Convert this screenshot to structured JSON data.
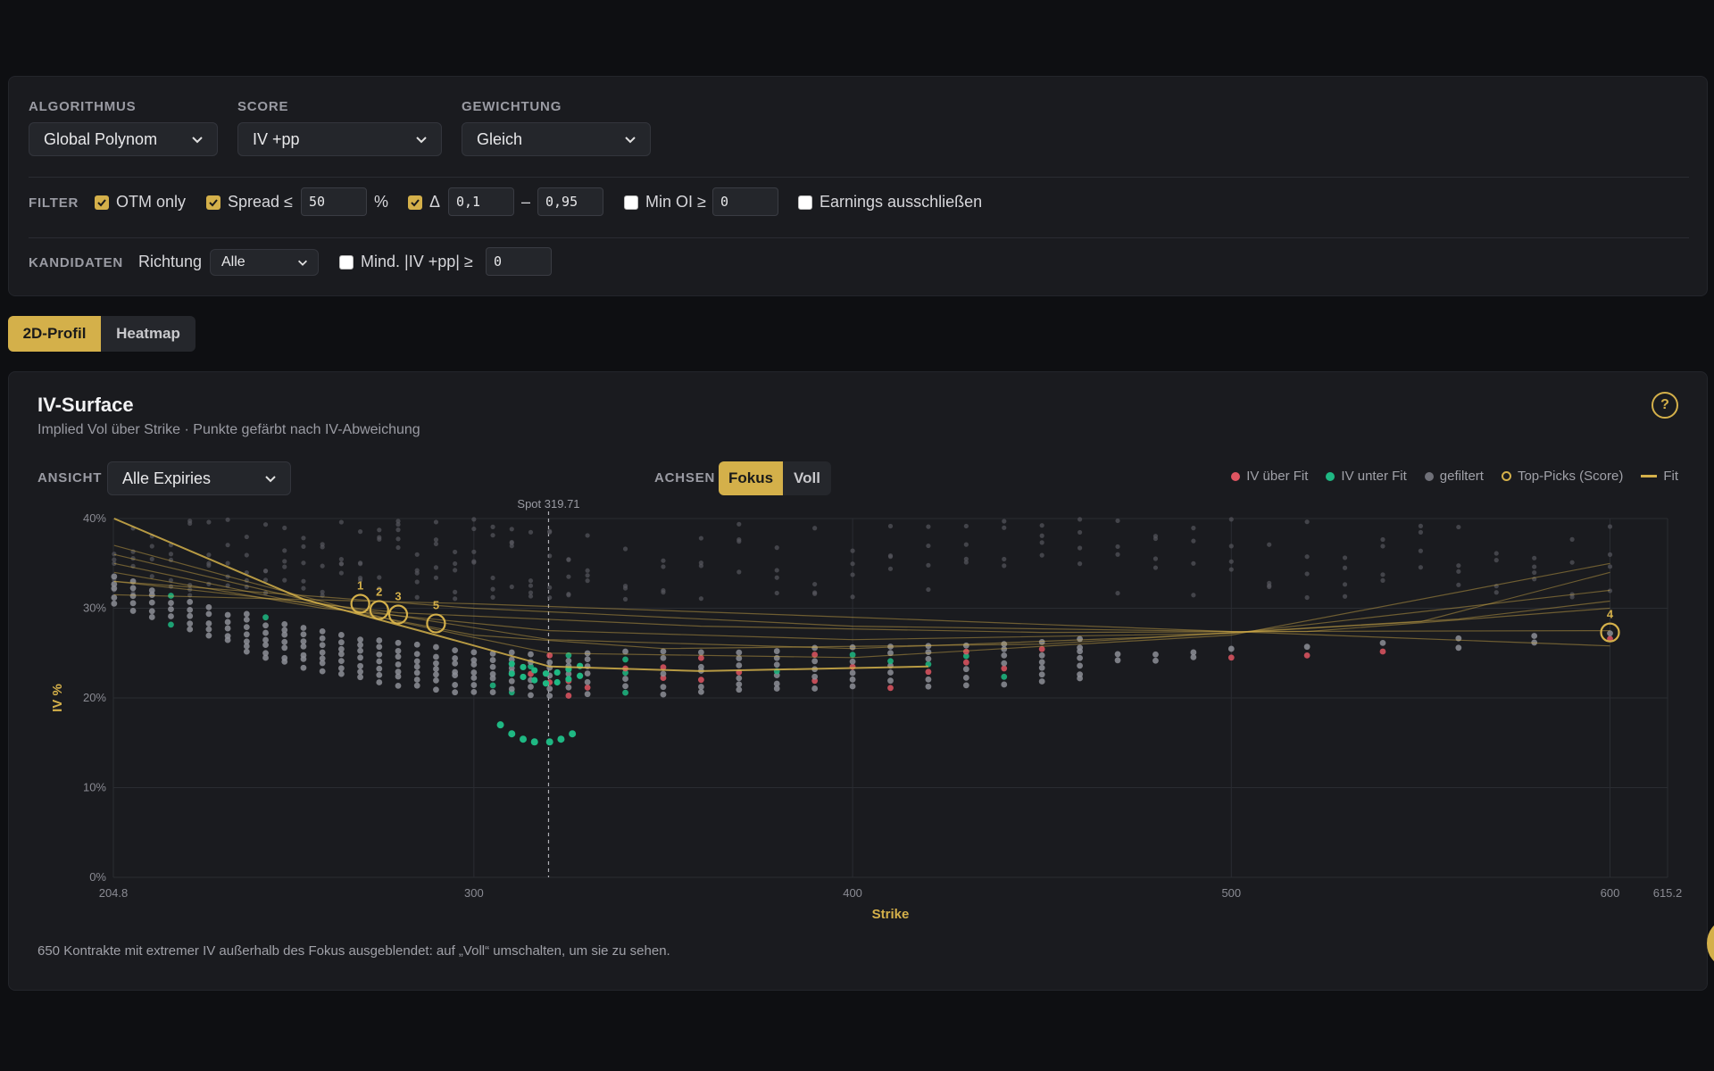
{
  "controls": {
    "algorithm": {
      "label": "ALGORITHMUS",
      "value": "Global Polynom"
    },
    "score": {
      "label": "SCORE",
      "value": "IV +pp"
    },
    "weighting": {
      "label": "GEWICHTUNG",
      "value": "Gleich"
    },
    "filter": {
      "label": "FILTER",
      "otm_label": "OTM only",
      "spread_label": "Spread ≤",
      "spread_value": "50",
      "spread_unit": "%",
      "delta_label": "Δ",
      "delta_min": "0,1",
      "delta_sep": "–",
      "delta_max": "0,95",
      "min_oi_label": "Min OI ≥",
      "min_oi_value": "0",
      "earnings_label": "Earnings ausschließen"
    },
    "candidates": {
      "label": "KANDIDATEN",
      "direction_label": "Richtung",
      "direction_value": "Alle",
      "min_iv_label": "Mind. |IV +pp| ≥",
      "min_iv_value": "0"
    }
  },
  "view_tabs": [
    "2D-Profil",
    "Heatmap"
  ],
  "panel": {
    "title": "IV-Surface",
    "subtitle": "Implied Vol über Strike · Punkte gefärbt nach IV-Abweichung",
    "help": "?",
    "view_label": "ANSICHT",
    "view_value": "Alle Expiries",
    "axes_label": "ACHSEN",
    "axes_options": [
      "Fokus",
      "Voll"
    ],
    "legend": [
      "IV über Fit",
      "IV unter Fit",
      "gefiltert",
      "Top-Picks (Score)",
      "Fit"
    ],
    "note": "650 Kontrakte mit extremer IV außerhalb des Fokus ausgeblendet: auf „Voll“ umschalten, um sie zu sehen."
  },
  "colors": {
    "accent": "#d4b04a",
    "above": "#e05561",
    "below": "#1fb883",
    "filtered": "#6f7078"
  },
  "chart_data": {
    "type": "scatter",
    "xlabel": "Strike",
    "ylabel": "IV %",
    "xlim": [
      204.8,
      615.2
    ],
    "ylim": [
      0,
      40
    ],
    "x_ticks": [
      "204.8",
      "300",
      "400",
      "500",
      "600",
      "615.2"
    ],
    "y_ticks": [
      "0%",
      "10%",
      "20%",
      "30%",
      "40%"
    ],
    "spot": {
      "label": "Spot 319.71",
      "value": 319.71
    },
    "grid": true,
    "top_picks": [
      {
        "rank": "1",
        "strike": 270,
        "iv": 30.5
      },
      {
        "rank": "2",
        "strike": 275,
        "iv": 29.8
      },
      {
        "rank": "3",
        "strike": 280,
        "iv": 29.3
      },
      {
        "rank": "5",
        "strike": 290,
        "iv": 28.3
      },
      {
        "rank": "4",
        "strike": 600,
        "iv": 27.3
      }
    ],
    "below_fit_smile": [
      {
        "strike": 307,
        "iv": 17.0
      },
      {
        "strike": 310,
        "iv": 16.0
      },
      {
        "strike": 313,
        "iv": 15.4
      },
      {
        "strike": 316,
        "iv": 15.1
      },
      {
        "strike": 320,
        "iv": 15.1
      },
      {
        "strike": 323,
        "iv": 15.4
      },
      {
        "strike": 326,
        "iv": 16.0
      }
    ],
    "fit_curves": [
      {
        "points": [
          [
            205,
            40
          ],
          [
            230,
            35.5
          ],
          [
            255,
            31
          ],
          [
            290,
            27
          ],
          [
            320,
            23.5
          ],
          [
            360,
            23
          ],
          [
            420,
            23.5
          ]
        ]
      },
      {
        "points": [
          [
            205,
            37
          ],
          [
            240,
            33
          ],
          [
            280,
            28.5
          ],
          [
            320,
            25
          ],
          [
            400,
            24.5
          ],
          [
            500,
            27
          ],
          [
            600,
            35
          ]
        ]
      },
      {
        "points": [
          [
            205,
            35
          ],
          [
            250,
            31
          ],
          [
            300,
            27
          ],
          [
            350,
            25.5
          ],
          [
            450,
            26
          ],
          [
            550,
            28.5
          ],
          [
            600,
            34
          ]
        ]
      },
      {
        "points": [
          [
            205,
            34
          ],
          [
            260,
            30
          ],
          [
            320,
            27.5
          ],
          [
            400,
            26.5
          ],
          [
            500,
            27.2
          ],
          [
            600,
            32
          ]
        ]
      },
      {
        "points": [
          [
            205,
            33
          ],
          [
            280,
            29.5
          ],
          [
            360,
            28
          ],
          [
            450,
            27.3
          ],
          [
            520,
            27.4
          ],
          [
            600,
            30
          ]
        ]
      },
      {
        "points": [
          [
            205,
            31.5
          ],
          [
            300,
            30.5
          ],
          [
            400,
            29
          ],
          [
            500,
            27.4
          ],
          [
            600,
            25.8
          ]
        ]
      },
      {
        "points": [
          [
            205,
            33
          ],
          [
            300,
            30
          ],
          [
            400,
            28
          ],
          [
            500,
            27.4
          ],
          [
            600,
            27.5
          ]
        ]
      },
      {
        "points": [
          [
            205,
            36
          ],
          [
            260,
            30.5
          ],
          [
            320,
            26.5
          ],
          [
            400,
            25.5
          ],
          [
            480,
            26.8
          ],
          [
            560,
            28.8
          ],
          [
            600,
            30.8
          ]
        ]
      }
    ]
  }
}
